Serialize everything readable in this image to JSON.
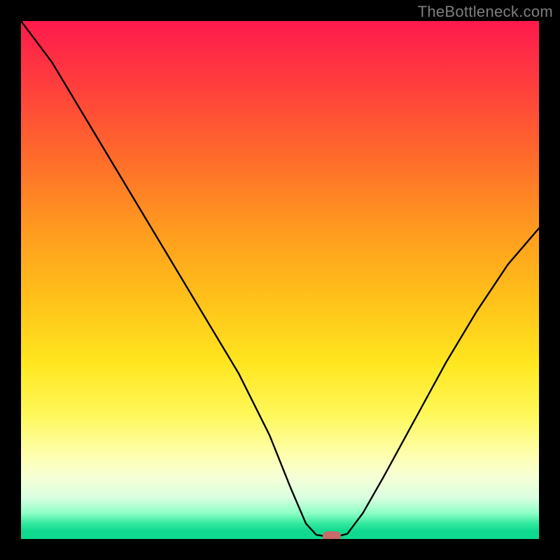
{
  "watermark": "TheBottleneck.com",
  "chart_data": {
    "type": "line",
    "title": "",
    "xlabel": "",
    "ylabel": "",
    "xlim": [
      0,
      100
    ],
    "ylim": [
      0,
      100
    ],
    "grid": false,
    "legend": false,
    "curve": [
      {
        "x": 0,
        "y": 100
      },
      {
        "x": 6,
        "y": 92
      },
      {
        "x": 12,
        "y": 82
      },
      {
        "x": 18,
        "y": 72
      },
      {
        "x": 24,
        "y": 62
      },
      {
        "x": 30,
        "y": 52
      },
      {
        "x": 36,
        "y": 42
      },
      {
        "x": 42,
        "y": 32
      },
      {
        "x": 48,
        "y": 20
      },
      {
        "x": 52,
        "y": 10
      },
      {
        "x": 55,
        "y": 3
      },
      {
        "x": 57,
        "y": 0.8
      },
      {
        "x": 59,
        "y": 0.5
      },
      {
        "x": 61,
        "y": 0.5
      },
      {
        "x": 63,
        "y": 1
      },
      {
        "x": 66,
        "y": 5
      },
      {
        "x": 70,
        "y": 12
      },
      {
        "x": 76,
        "y": 23
      },
      {
        "x": 82,
        "y": 34
      },
      {
        "x": 88,
        "y": 44
      },
      {
        "x": 94,
        "y": 53
      },
      {
        "x": 100,
        "y": 60
      }
    ],
    "marker": {
      "x": 60,
      "y": 0.5,
      "color": "#c76a6a"
    },
    "gradient_stops": [
      {
        "pos": 0,
        "color": "#ff1a4d"
      },
      {
        "pos": 0.5,
        "color": "#ffe61f"
      },
      {
        "pos": 0.85,
        "color": "#fdffb0"
      },
      {
        "pos": 1.0,
        "color": "#0fd98e"
      }
    ]
  }
}
